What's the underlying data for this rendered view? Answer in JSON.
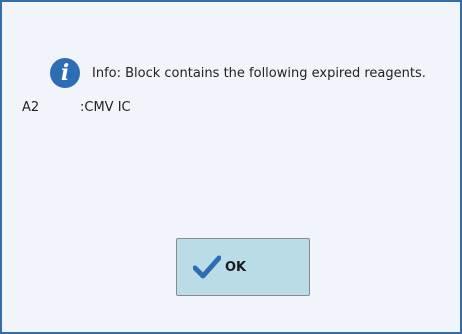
{
  "dialog": {
    "info_icon": "info-icon",
    "message": "Info: Block contains the following expired reagents.",
    "reagents": [
      {
        "position": "A2",
        "name": ":CMV IC"
      }
    ],
    "ok_button": {
      "label": "OK",
      "icon": "checkmark-icon"
    }
  },
  "colors": {
    "border": "#2f6fad",
    "background": "#f1f5fb",
    "button": "#b9dce7",
    "accent": "#2d6db5"
  }
}
